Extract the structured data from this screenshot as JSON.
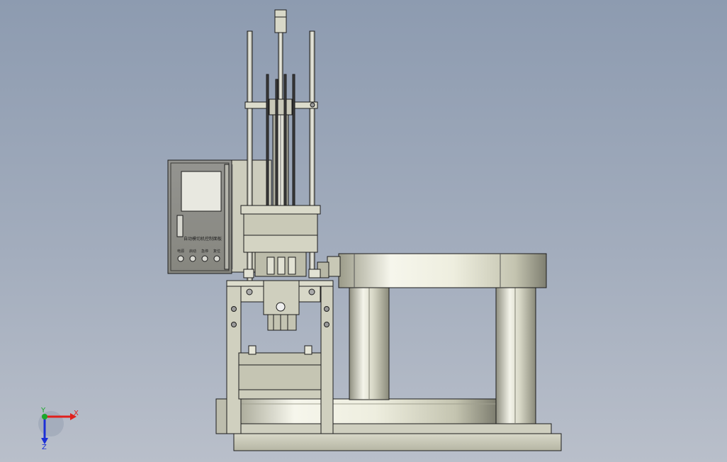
{
  "viewport": {
    "background_top": "#8d9bb0",
    "background_bottom": "#b9bfca"
  },
  "control_panel": {
    "title": "自动模切机控制面板",
    "buttons": [
      "电源",
      "启动",
      "急停",
      "复位"
    ]
  },
  "triad": {
    "x_label": "X",
    "y_label": "Y",
    "z_label": "Z",
    "x_color": "#e0201c",
    "y_color": "#1aa82a",
    "z_color": "#1b2fd6"
  },
  "colors": {
    "metal_light": "#e9e9dc",
    "metal_mid": "#c9c9b6",
    "metal_dark": "#8c8c7e",
    "panel_face": "#8e8e86",
    "outline": "#1c1c1c"
  }
}
